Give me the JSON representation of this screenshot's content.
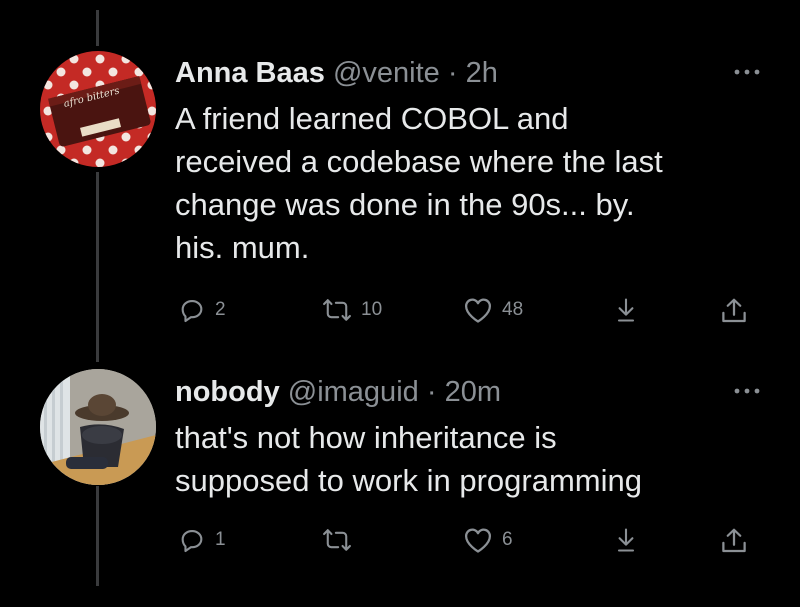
{
  "tweets": [
    {
      "display_name": "Anna Baas",
      "handle": "@venite",
      "separator": "·",
      "time": "2h",
      "text_lines": [
        "A friend learned COBOL and",
        "received a codebase where the last",
        "change was done in the 90s... by.",
        "his. mum."
      ],
      "replies": "2",
      "retweets": "10",
      "likes": "48",
      "avatar_caption": "afro bitters"
    },
    {
      "display_name": "nobody",
      "handle": "@imaguid",
      "separator": "·",
      "time": "20m",
      "text_lines": [
        "that's not how inheritance is",
        "supposed to work in programming"
      ],
      "replies": "1",
      "retweets": "",
      "likes": "6"
    }
  ],
  "icons": {
    "reply": "reply-icon",
    "retweet": "retweet-icon",
    "like": "heart-icon",
    "download": "download-icon",
    "share": "share-icon",
    "more": "more-icon"
  },
  "colors": {
    "background": "#000000",
    "text_primary": "#e7e9ea",
    "text_secondary": "#8b9095",
    "thread_line": "#3a3b3d"
  }
}
